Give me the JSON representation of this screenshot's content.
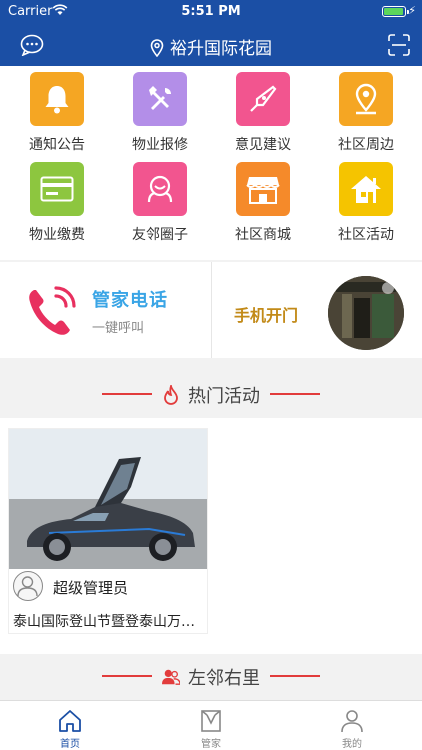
{
  "status_bar": {
    "carrier": "Carrier",
    "time": "5:51 PM"
  },
  "navbar": {
    "title": "裕升国际花园",
    "chat_icon": "chat-bubble-icon",
    "scan_icon": "scan-icon",
    "location_icon": "location-pin-icon"
  },
  "grid": {
    "items": [
      {
        "label": "通知公告",
        "color": "#f5a623",
        "icon": "bell-icon"
      },
      {
        "label": "物业报修",
        "color": "#b38ee8",
        "icon": "wrench-screwdriver-icon"
      },
      {
        "label": "意见建议",
        "color": "#f2558f",
        "icon": "pen-nib-icon"
      },
      {
        "label": "社区周边",
        "color": "#f5a623",
        "icon": "map-pin-icon"
      },
      {
        "label": "物业缴费",
        "color": "#8dc63f",
        "icon": "card-icon"
      },
      {
        "label": "友邻圈子",
        "color": "#f2558f",
        "icon": "neighbor-icon"
      },
      {
        "label": "社区商城",
        "color": "#f58a2a",
        "icon": "shop-icon"
      },
      {
        "label": "社区活动",
        "color": "#f5c400",
        "icon": "house-icon"
      }
    ]
  },
  "quick": {
    "phone_title": "管家电话",
    "phone_sub": "一键呼叫",
    "door_label": "手机开门"
  },
  "sections": {
    "hot_activity": "热门活动",
    "neighbors": "左邻右里"
  },
  "activity_card": {
    "author": "超级管理员",
    "description": "泰山国际登山节暨登泰山万人徒步活动"
  },
  "tabbar": {
    "tabs": [
      {
        "label": "首页",
        "active": true
      },
      {
        "label": "管家",
        "active": false
      },
      {
        "label": "我的",
        "active": false
      }
    ]
  },
  "colors": {
    "brand": "#1b4fa5",
    "accent_red": "#e23c3c",
    "phone_blue": "#3aa5e6"
  }
}
